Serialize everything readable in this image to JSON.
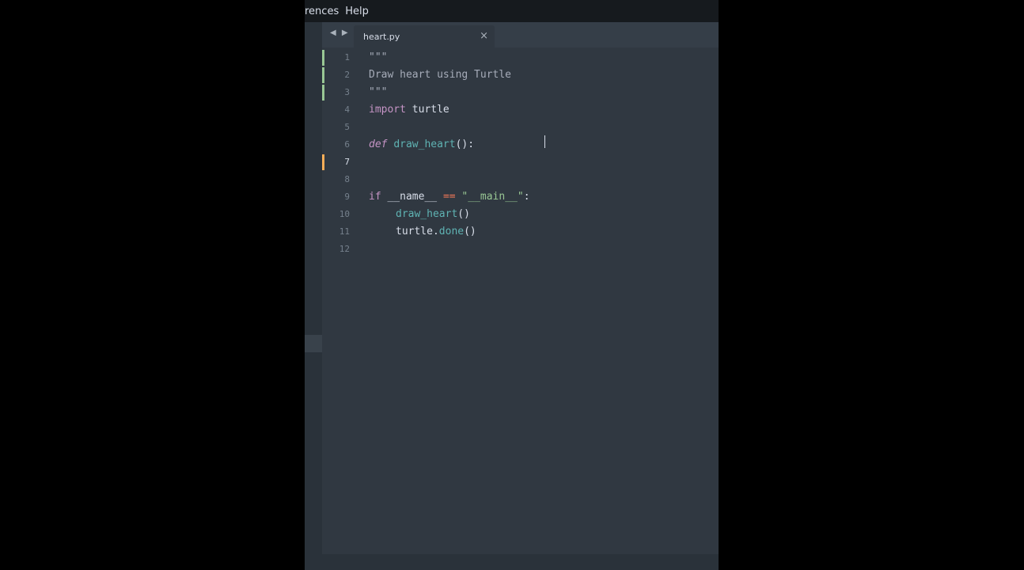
{
  "menubar": {
    "items": [
      "rences",
      "Help"
    ]
  },
  "tab": {
    "nav_arrows": "◀ ▶",
    "title": "heart.py",
    "close": "×"
  },
  "editor": {
    "lines": [
      {
        "num": "1",
        "text": "\"\"\""
      },
      {
        "num": "2",
        "text": "Draw heart using Turtle"
      },
      {
        "num": "3",
        "text": "\"\"\""
      },
      {
        "num": "4",
        "kw": "import",
        "rest": " turtle"
      },
      {
        "num": "5"
      },
      {
        "num": "6",
        "kw": "def",
        "fn": "draw_heart",
        "rest": "():"
      },
      {
        "num": "7"
      },
      {
        "num": "8"
      },
      {
        "num": "9",
        "kw": "if",
        "var": " __name__ ",
        "op": "==",
        "str": " \"__main__\"",
        "rest": ":"
      },
      {
        "num": "10",
        "fn": "draw_heart",
        "rest": "()"
      },
      {
        "num": "11",
        "obj": "turtle",
        "dot": ".",
        "fn": "done",
        "rest": "()"
      },
      {
        "num": "12"
      }
    ]
  },
  "colors": {
    "background": "#303841",
    "menubar": "#161a1e",
    "keyword": "#c594c5",
    "function": "#5fb3b3",
    "operator": "#f97b58",
    "string": "#99c794",
    "modified_marker_green": "#99c794",
    "modified_marker_orange": "#f9ae58"
  }
}
